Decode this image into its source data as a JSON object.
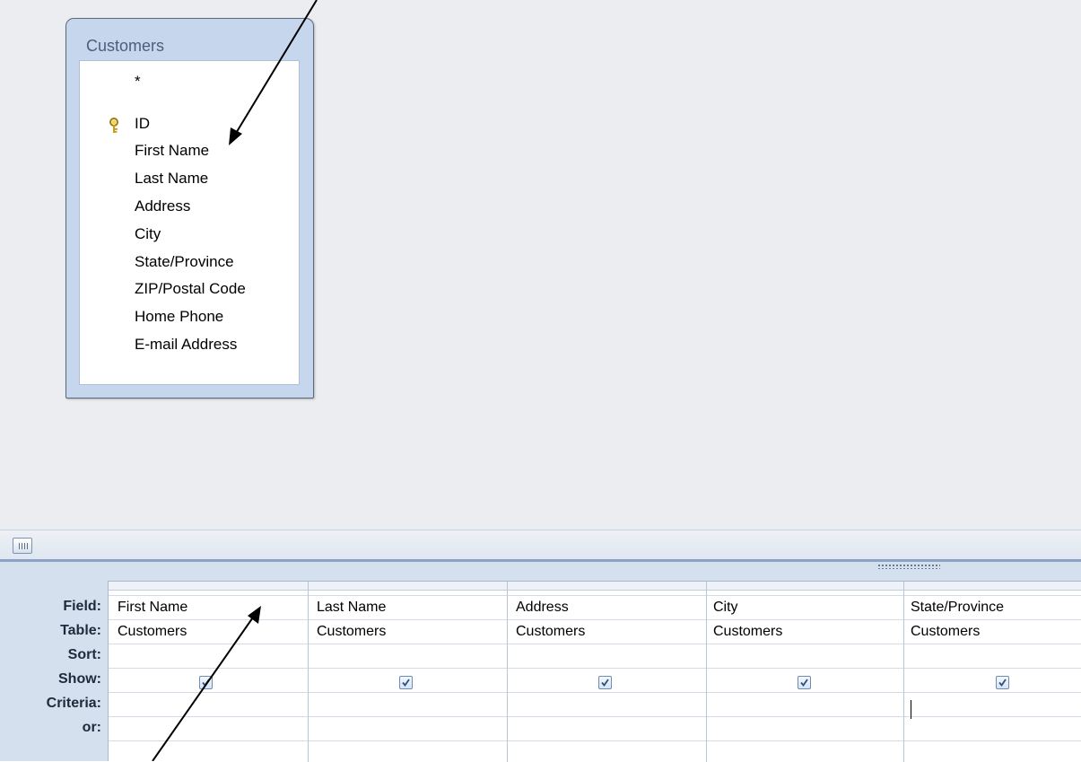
{
  "table": {
    "title": "Customers",
    "fields": [
      "*",
      "ID",
      "First Name",
      "Last Name",
      "Address",
      "City",
      "State/Province",
      "ZIP/Postal Code",
      "Home Phone",
      "E-mail Address"
    ],
    "key_icon": "key-icon"
  },
  "grid": {
    "row_labels": [
      "Field:",
      "Table:",
      "Sort:",
      "Show:",
      "Criteria:",
      "or:"
    ],
    "columns": [
      {
        "field": "First Name",
        "table": "Customers",
        "sort": "",
        "show": true,
        "criteria": "",
        "or": ""
      },
      {
        "field": "Last Name",
        "table": "Customers",
        "sort": "",
        "show": true,
        "criteria": "",
        "or": ""
      },
      {
        "field": "Address",
        "table": "Customers",
        "sort": "",
        "show": true,
        "criteria": "",
        "or": ""
      },
      {
        "field": "City",
        "table": "Customers",
        "sort": "",
        "show": true,
        "criteria": "",
        "or": ""
      },
      {
        "field": "State/Province",
        "table": "Customers",
        "sort": "",
        "show": true,
        "criteria": "",
        "or": ""
      }
    ]
  },
  "colors": {
    "design_bg": "#ebedf0",
    "grid_panel": "#d5e0ef",
    "table_border": "#5c6a7e",
    "annotation_arrow": "#000000"
  }
}
